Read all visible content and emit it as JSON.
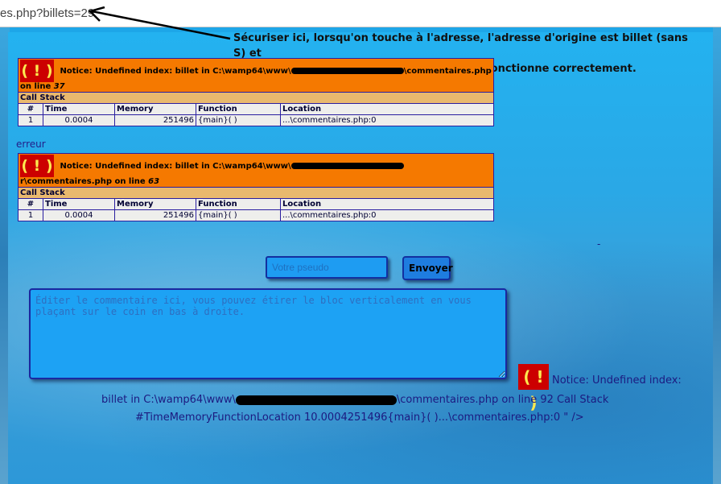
{
  "browser": {
    "url": "es.php?billets=29"
  },
  "annotation": {
    "line1": "Sécuriser ici, lorsqu'on touche à l'adresse, l'adresse d'origine est billet (sans S) et",
    "line2": "avec l'adresse d'origine pas de souci, tout fonctionne correctement."
  },
  "errors": [
    {
      "notice_prefix": "Notice: Undefined index: billet in C:\\wamp64\\www\\",
      "notice_suffix": "\\commentaires.php on line ",
      "line": "37",
      "call_stack": "Call Stack",
      "cols": [
        "#",
        "Time",
        "Memory",
        "Function",
        "Location"
      ],
      "row": [
        "1",
        "0.0004",
        "251496",
        "{main}( )",
        "...\\commentaires.php:0"
      ]
    },
    {
      "notice_prefix": "Notice: Undefined index: billet in C:\\wamp64\\www\\",
      "notice_suffix": "r\\commentaires.php on line ",
      "line": "63",
      "call_stack": "Call Stack",
      "cols": [
        "#",
        "Time",
        "Memory",
        "Function",
        "Location"
      ],
      "row": [
        "1",
        "0.0004",
        "251496",
        "{main}( )",
        "...\\commentaires.php:0"
      ]
    }
  ],
  "erreur_label": "erreur",
  "bang": "( ! )",
  "dash": "-",
  "form": {
    "pseudo_placeholder": "Votre pseudo",
    "send_label": "Envoyer",
    "comment_placeholder": "Éditer le commentaire ici, vous pouvez étirer le bloc verticalement en vous plaçant sur le coin en bas à droite."
  },
  "bottom_notice": {
    "line1": "Notice: Undefined index:",
    "line2_prefix": "billet in C:\\wamp64\\www\\",
    "line2_suffix": "\\commentaires.php on line 92 Call Stack",
    "line3": "#TimeMemoryFunctionLocation 10.0004251496{main}( )...\\commentaires.php:0 \" />"
  },
  "colors": {
    "notice_header": "#f57900",
    "call_stack_bg": "#e9b96e",
    "bang_bg": "#cc0000",
    "bang_fg": "#fce94f",
    "page_bg": "#23b2f0"
  }
}
